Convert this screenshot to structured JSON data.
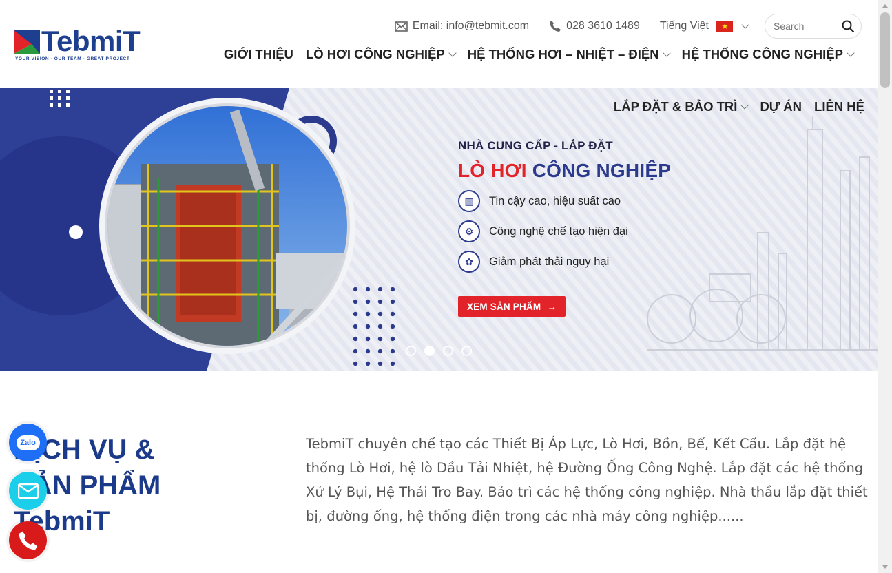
{
  "logo": {
    "word": "TebmiT",
    "tagline": "YOUR VISION - OUR TEAM - GREAT PROJECT",
    "colors": {
      "navy": "#1e3f8f",
      "red": "#e2232a",
      "green": "#2a9a3d"
    }
  },
  "topbar": {
    "email_label": "Email: info@tebmit.com",
    "phone_label": "028 3610 1489",
    "language_label": "Tiếng Việt",
    "search_placeholder": "Search",
    "icons": {
      "email": "envelope-icon",
      "phone": "phone-icon",
      "flag": "vietnam-flag-icon",
      "search": "search-icon"
    }
  },
  "nav": {
    "items": [
      {
        "label": "GIỚI THIỆU",
        "dropdown": false
      },
      {
        "label": "LÒ HƠI CÔNG NGHIỆP",
        "dropdown": true
      },
      {
        "label": "HỆ THỐNG HƠI – NHIỆT – ĐIỆN",
        "dropdown": true
      },
      {
        "label": "HỆ THỐNG CÔNG NGHIỆP",
        "dropdown": true
      }
    ],
    "sub_items": [
      {
        "label": "LẮP ĐẶT & BẢO TRÌ",
        "dropdown": true
      },
      {
        "label": "DỰ ÁN",
        "dropdown": false
      },
      {
        "label": "LIÊN HỆ",
        "dropdown": false
      }
    ]
  },
  "hero": {
    "kicker": "NHÀ CUNG CẤP - LẮP ĐẶT",
    "headline_red": "LÒ HƠI",
    "headline_blue": "CÔNG NGHIỆP",
    "features": [
      {
        "icon": "boiler-icon",
        "text": "Tin cậy cao, hiệu suất cao"
      },
      {
        "icon": "gears-icon",
        "text": "Công nghệ chế tạo hiện đại"
      },
      {
        "icon": "eco-icon",
        "text": "Giảm phát thải nguy hại"
      }
    ],
    "cta_label": "XEM SẢN PHẨM",
    "slides": {
      "count": 4,
      "active": 2
    },
    "colors": {
      "navy": "#2b3a8c",
      "red": "#e2232a",
      "bg": "#eceef5"
    }
  },
  "services": {
    "title_line1": "DỊCH VỤ &",
    "title_line2": "SẢN PHẨM",
    "title_line3": "TebmiT",
    "description": "TebmiT chuyên chế tạo các Thiết Bị Áp Lực, Lò Hơi, Bồn, Bể, Kết Cấu. Lắp đặt hệ thống Lò Hơi, hệ lò Dầu Tải Nhiệt, hệ Đường Ống Công Nghệ. Lắp đặt các hệ thống Xử Lý Bụi, Hệ Thải Tro Bay. Bảo trì các hệ thống công nghiệp. Nhà thầu lắp đặt thiết bị, đường ống, hệ thống điện trong các nhà máy công nghiệp......"
  },
  "floating": {
    "zalo_label": "Zalo",
    "items": [
      {
        "icon": "zalo-icon",
        "color": "#1e6ff5"
      },
      {
        "icon": "mail-icon",
        "color": "#1bcfea"
      },
      {
        "icon": "phone-call-icon",
        "color": "#d91a1a"
      }
    ]
  }
}
